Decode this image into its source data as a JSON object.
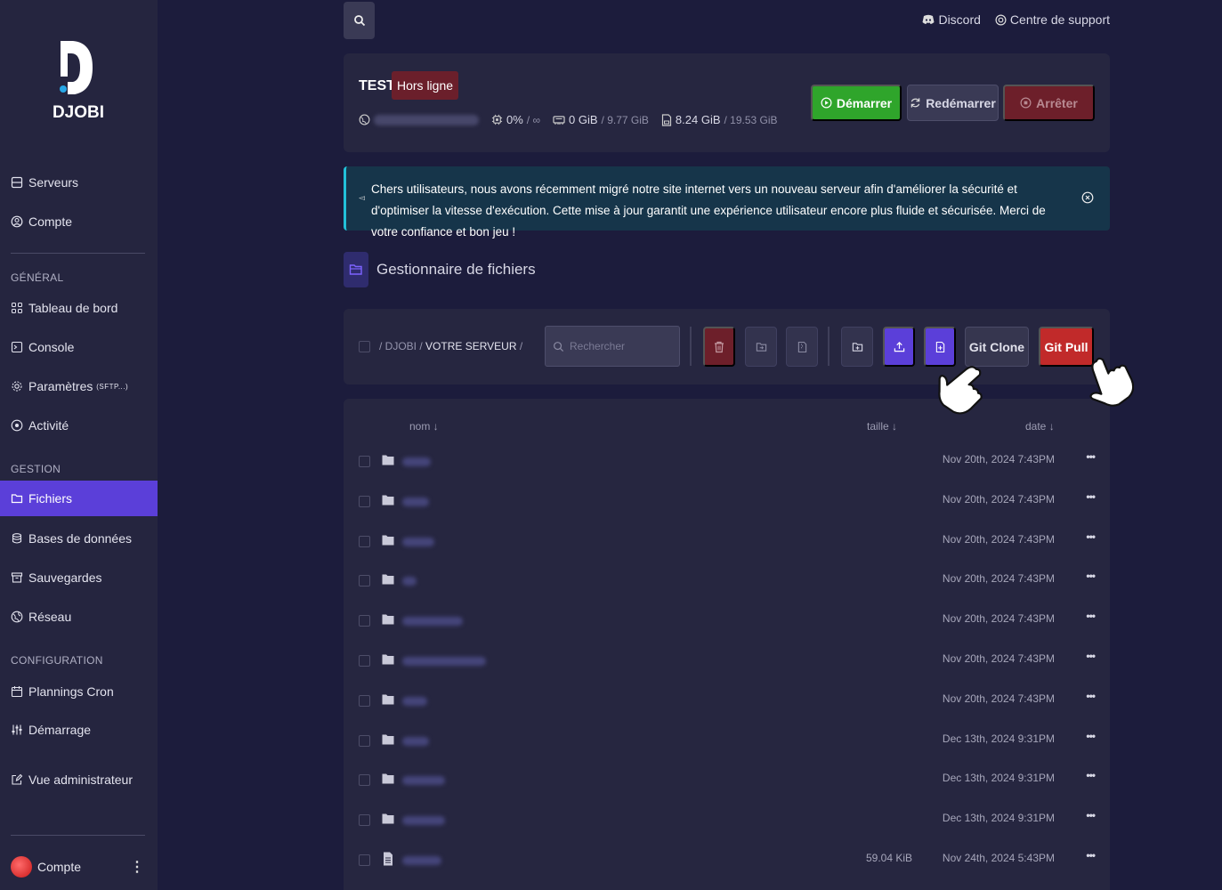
{
  "sidebar": {
    "logo_text": "DJOBI",
    "top_items": [
      {
        "label": "Serveurs",
        "icon": "server-icon"
      },
      {
        "label": "Compte",
        "icon": "user-circle-icon"
      }
    ],
    "sections": {
      "general": "GÉNÉRAL",
      "gestion": "GESTION",
      "configuration": "CONFIGURATION"
    },
    "general_items": {
      "dashboard": "Tableau de bord",
      "console": "Console",
      "settings": "Paramètres",
      "settings_suffix": "(SFTP...)",
      "activity": "Activité"
    },
    "gestion_items": {
      "files": "Fichiers",
      "databases": "Bases de données",
      "backups": "Sauvegardes",
      "network": "Réseau"
    },
    "config_items": {
      "schedules": "Plannings Cron",
      "startup": "Démarrage"
    },
    "admin_view": "Vue administrateur",
    "account": "Compte"
  },
  "topbar": {
    "discord": "Discord",
    "support": "Centre de support"
  },
  "server": {
    "name": "TEST",
    "status": "Hors ligne",
    "cpu": "0%",
    "cpu_limit": "/ ∞",
    "memory": "0 GiB",
    "memory_limit": "/ 9.77 GiB",
    "disk": "8.24 GiB",
    "disk_limit": "/ 19.53 GiB",
    "start_label": "Démarrer",
    "restart_label": "Redémarrer",
    "stop_label": "Arrêter"
  },
  "announcement": {
    "text": "Chers utilisateurs, nous avons récemment migré notre site internet vers un nouveau serveur afin d'améliorer la sécurité et d'optimiser la vitesse d'exécution. Cette mise à jour garantit une expérience utilisateur encore plus fluide et sécurisée. Merci de votre confiance et bon jeu !"
  },
  "file_manager": {
    "title": "Gestionnaire de fichiers",
    "breadcrumb_root": "DJOBI",
    "breadcrumb_current": "VOTRE SERVEUR",
    "search_placeholder": "Rechercher",
    "git_clone": "Git Clone",
    "git_pull": "Git Pull",
    "columns": {
      "name": "nom ↓",
      "size": "taille ↓",
      "date": "date ↓"
    },
    "rows": [
      {
        "type": "folder",
        "size": "",
        "date": "Nov 20th, 2024 7:43PM"
      },
      {
        "type": "folder",
        "size": "",
        "date": "Nov 20th, 2024 7:43PM"
      },
      {
        "type": "folder",
        "size": "",
        "date": "Nov 20th, 2024 7:43PM"
      },
      {
        "type": "folder",
        "size": "",
        "date": "Nov 20th, 2024 7:43PM"
      },
      {
        "type": "folder",
        "size": "",
        "date": "Nov 20th, 2024 7:43PM"
      },
      {
        "type": "folder",
        "size": "",
        "date": "Nov 20th, 2024 7:43PM"
      },
      {
        "type": "folder",
        "size": "",
        "date": "Nov 20th, 2024 7:43PM"
      },
      {
        "type": "folder",
        "size": "",
        "date": "Dec 13th, 2024 9:31PM"
      },
      {
        "type": "folder",
        "size": "",
        "date": "Dec 13th, 2024 9:31PM"
      },
      {
        "type": "folder",
        "size": "",
        "date": "Dec 13th, 2024 9:31PM"
      },
      {
        "type": "file",
        "size": "59.04 KiB",
        "date": "Nov 24th, 2024 5:43PM"
      }
    ],
    "more_symbol": "•••"
  },
  "colors": {
    "accent": "#5b3fd9",
    "success": "#2fa52b",
    "danger": "#c12a2a",
    "background": "#1c1c3c",
    "panel": "#262640"
  }
}
